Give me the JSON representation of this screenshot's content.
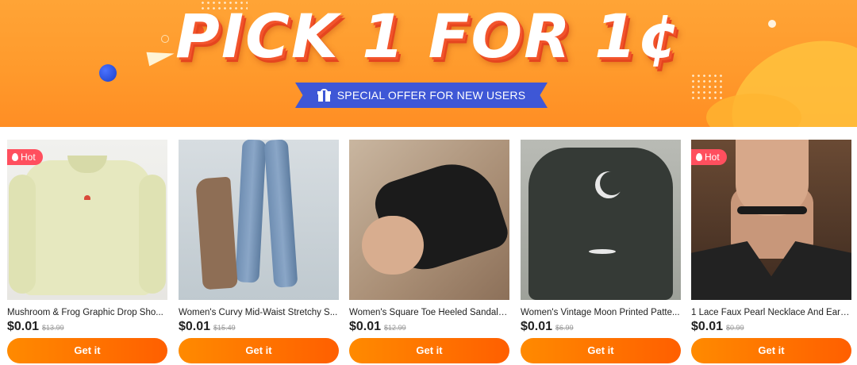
{
  "banner": {
    "headline": "PICK 1 FOR 1¢",
    "ribbon_text": "SPECIAL OFFER FOR NEW USERS",
    "colors": {
      "background": "#ff9a2c",
      "ribbon": "#3e57d6",
      "headline_shadow": "#f2542c"
    }
  },
  "products": [
    {
      "hot": "Hot",
      "title": "Mushroom & Frog Graphic Drop Sho...",
      "price": "$0.01",
      "original_price": "$13.99",
      "button": "Get it"
    },
    {
      "hot": "",
      "title": "Women's Curvy Mid-Waist Stretchy S...",
      "price": "$0.01",
      "original_price": "$15.49",
      "button": "Get it"
    },
    {
      "hot": "",
      "title": "Women's Square Toe Heeled Sandal C...",
      "price": "$0.01",
      "original_price": "$12.99",
      "button": "Get it"
    },
    {
      "hot": "",
      "title": "Women's Vintage Moon Printed Patte...",
      "price": "$0.01",
      "original_price": "$6.99",
      "button": "Get it"
    },
    {
      "hot": "Hot",
      "title": "1 Lace Faux Pearl Necklace And Earrin...",
      "price": "$0.01",
      "original_price": "$0.99",
      "button": "Get it"
    }
  ],
  "accent_color": "#ff6a00"
}
